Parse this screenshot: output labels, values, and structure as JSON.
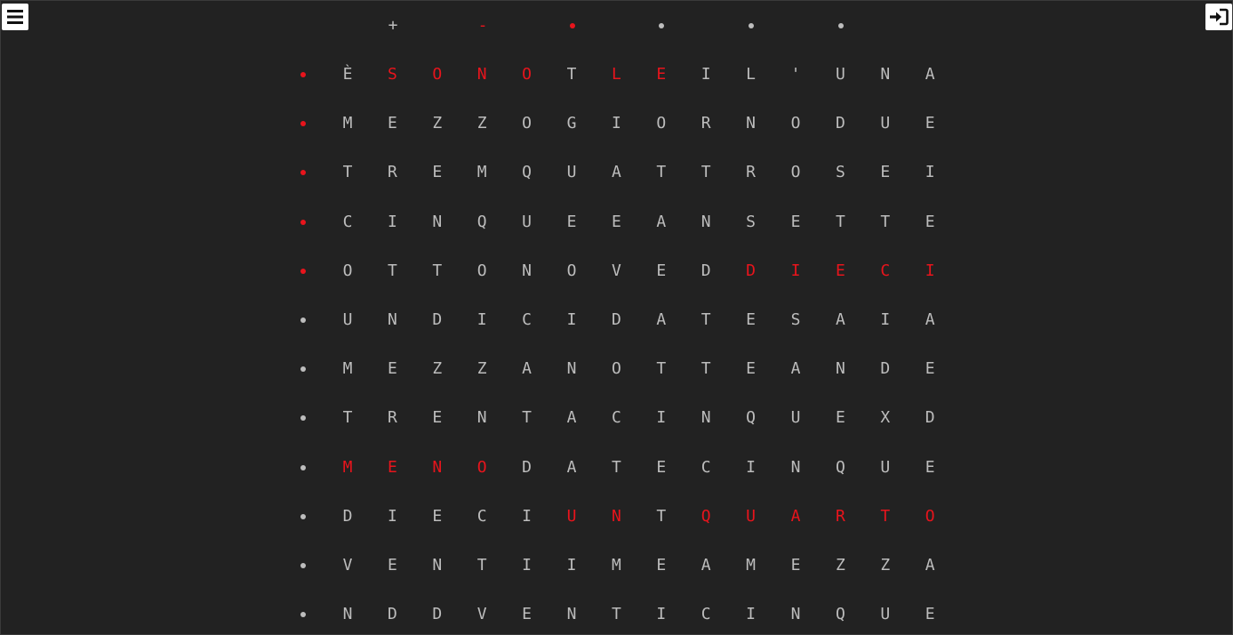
{
  "toolbar": {
    "menu_icon": "hamburger-menu-icon",
    "login_icon": "sign-in-icon"
  },
  "colors": {
    "background": "#222222",
    "letter_off": "#bdbdbd",
    "letter_on": "#e8141c",
    "button_bg": "#ffffff"
  },
  "minute_indicator": {
    "plus_label": "+",
    "minus_label": "-",
    "plus_on": false,
    "minus_on": true,
    "dots_on": [
      true,
      false,
      false,
      false
    ]
  },
  "grid": {
    "rows": [
      {
        "dot_on": true,
        "letters": [
          "È",
          "S",
          "O",
          "N",
          "O",
          "T",
          "L",
          "E",
          "I",
          "L",
          "'",
          "U",
          "N",
          "A"
        ],
        "on": [
          false,
          true,
          true,
          true,
          true,
          false,
          true,
          true,
          false,
          false,
          false,
          false,
          false,
          false
        ]
      },
      {
        "dot_on": true,
        "letters": [
          "M",
          "E",
          "Z",
          "Z",
          "O",
          "G",
          "I",
          "O",
          "R",
          "N",
          "O",
          "D",
          "U",
          "E"
        ],
        "on": [
          false,
          false,
          false,
          false,
          false,
          false,
          false,
          false,
          false,
          false,
          false,
          false,
          false,
          false
        ]
      },
      {
        "dot_on": true,
        "letters": [
          "T",
          "R",
          "E",
          "M",
          "Q",
          "U",
          "A",
          "T",
          "T",
          "R",
          "O",
          "S",
          "E",
          "I"
        ],
        "on": [
          false,
          false,
          false,
          false,
          false,
          false,
          false,
          false,
          false,
          false,
          false,
          false,
          false,
          false
        ]
      },
      {
        "dot_on": true,
        "letters": [
          "C",
          "I",
          "N",
          "Q",
          "U",
          "E",
          "E",
          "A",
          "N",
          "S",
          "E",
          "T",
          "T",
          "E"
        ],
        "on": [
          false,
          false,
          false,
          false,
          false,
          false,
          false,
          false,
          false,
          false,
          false,
          false,
          false,
          false
        ]
      },
      {
        "dot_on": true,
        "letters": [
          "O",
          "T",
          "T",
          "O",
          "N",
          "O",
          "V",
          "E",
          "D",
          "D",
          "I",
          "E",
          "C",
          "I"
        ],
        "on": [
          false,
          false,
          false,
          false,
          false,
          false,
          false,
          false,
          false,
          true,
          true,
          true,
          true,
          true
        ]
      },
      {
        "dot_on": false,
        "letters": [
          "U",
          "N",
          "D",
          "I",
          "C",
          "I",
          "D",
          "A",
          "T",
          "E",
          "S",
          "A",
          "I",
          "A"
        ],
        "on": [
          false,
          false,
          false,
          false,
          false,
          false,
          false,
          false,
          false,
          false,
          false,
          false,
          false,
          false
        ]
      },
      {
        "dot_on": false,
        "letters": [
          "M",
          "E",
          "Z",
          "Z",
          "A",
          "N",
          "O",
          "T",
          "T",
          "E",
          "A",
          "N",
          "D",
          "E"
        ],
        "on": [
          false,
          false,
          false,
          false,
          false,
          false,
          false,
          false,
          false,
          false,
          false,
          false,
          false,
          false
        ]
      },
      {
        "dot_on": false,
        "letters": [
          "T",
          "R",
          "E",
          "N",
          "T",
          "A",
          "C",
          "I",
          "N",
          "Q",
          "U",
          "E",
          "X",
          "D"
        ],
        "on": [
          false,
          false,
          false,
          false,
          false,
          false,
          false,
          false,
          false,
          false,
          false,
          false,
          false,
          false
        ]
      },
      {
        "dot_on": false,
        "letters": [
          "M",
          "E",
          "N",
          "O",
          "D",
          "A",
          "T",
          "E",
          "C",
          "I",
          "N",
          "Q",
          "U",
          "E"
        ],
        "on": [
          true,
          true,
          true,
          true,
          false,
          false,
          false,
          false,
          false,
          false,
          false,
          false,
          false,
          false
        ]
      },
      {
        "dot_on": false,
        "letters": [
          "D",
          "I",
          "E",
          "C",
          "I",
          "U",
          "N",
          "T",
          "Q",
          "U",
          "A",
          "R",
          "T",
          "O"
        ],
        "on": [
          false,
          false,
          false,
          false,
          false,
          true,
          true,
          false,
          true,
          true,
          true,
          true,
          true,
          true
        ]
      },
      {
        "dot_on": false,
        "letters": [
          "V",
          "E",
          "N",
          "T",
          "I",
          "I",
          "M",
          "E",
          "A",
          "M",
          "E",
          "Z",
          "Z",
          "A"
        ],
        "on": [
          false,
          false,
          false,
          false,
          false,
          false,
          false,
          false,
          false,
          false,
          false,
          false,
          false,
          false
        ]
      },
      {
        "dot_on": false,
        "letters": [
          "N",
          "D",
          "D",
          "V",
          "E",
          "N",
          "T",
          "I",
          "C",
          "I",
          "N",
          "Q",
          "U",
          "E"
        ],
        "on": [
          false,
          false,
          false,
          false,
          false,
          false,
          false,
          false,
          false,
          false,
          false,
          false,
          false,
          false
        ]
      }
    ]
  }
}
